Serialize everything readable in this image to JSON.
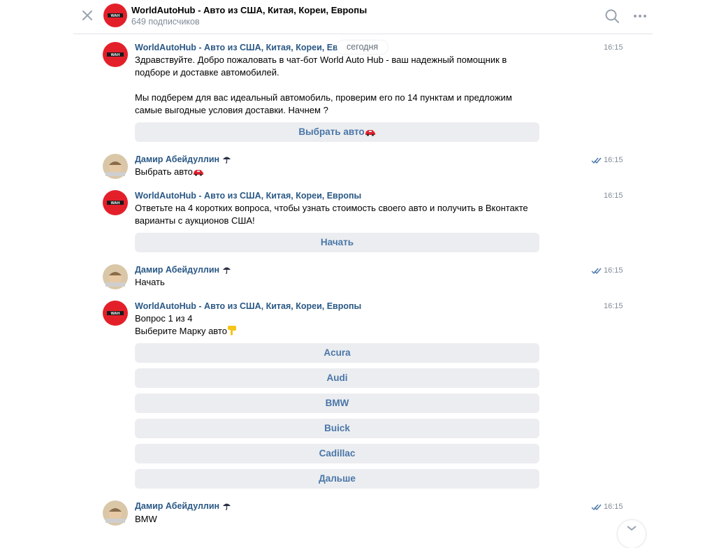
{
  "header": {
    "title": "WorldAutoHub - Авто из США, Китая, Кореи, Европы",
    "subscribers": "649 подписчиков",
    "avatar_text": "WAH"
  },
  "date_divider": "сегодня",
  "messages": [
    {
      "author": "WorldAutoHub - Авто из США, Китая, Кореи, Европы",
      "time": "16:15",
      "lines": [
        "Здравствуйте. Добро пожаловать в чат-бот World Auto Hub - ваш надежный помощник в",
        "подборе и доставке автомобилей.",
        "",
        "Мы подберем для вас идеальный автомобиль, проверим его по 14 пунктам и предложим",
        "самые выгодные условия доставки. Начнем ?"
      ],
      "buttons": [
        "Выбрать авто"
      ]
    },
    {
      "author": "Дамир Абейдуллин",
      "time": "16:15",
      "lines": [
        "Выбрать авто"
      ]
    },
    {
      "author": "WorldAutoHub - Авто из США, Китая, Кореи, Европы",
      "time": "16:15",
      "lines": [
        "Ответьте на 4 коротких вопроса, чтобы узнать стоимость своего авто и получить в Вконтакте",
        "варианты с аукционов США!"
      ],
      "buttons": [
        "Начать"
      ]
    },
    {
      "author": "Дамир Абейдуллин",
      "time": "16:15",
      "lines": [
        "Начать"
      ]
    },
    {
      "author": "WorldAutoHub - Авто из США, Китая, Кореи, Европы",
      "time": "16:15",
      "lines": [
        "Вопрос 1 из 4",
        "Выберите Марку авто"
      ],
      "buttons": [
        "Acura",
        "Audi",
        "BMW",
        "Buick",
        "Cadillac",
        "Дальше"
      ]
    },
    {
      "author": "Дамир Абейдуллин",
      "time": "16:15",
      "lines": [
        "BMW"
      ]
    }
  ],
  "colors": {
    "link": "#2a5885",
    "button_text": "#4a76a8",
    "button_bg": "#ebedf0",
    "secondary": "#818c99",
    "brand_red": "#e3202a"
  },
  "icons": [
    "close-icon",
    "search-icon",
    "more-icon",
    "read-check-icon",
    "car-emoji",
    "pointing-down-emoji",
    "umbrella-emoji",
    "chevron-down-icon"
  ]
}
